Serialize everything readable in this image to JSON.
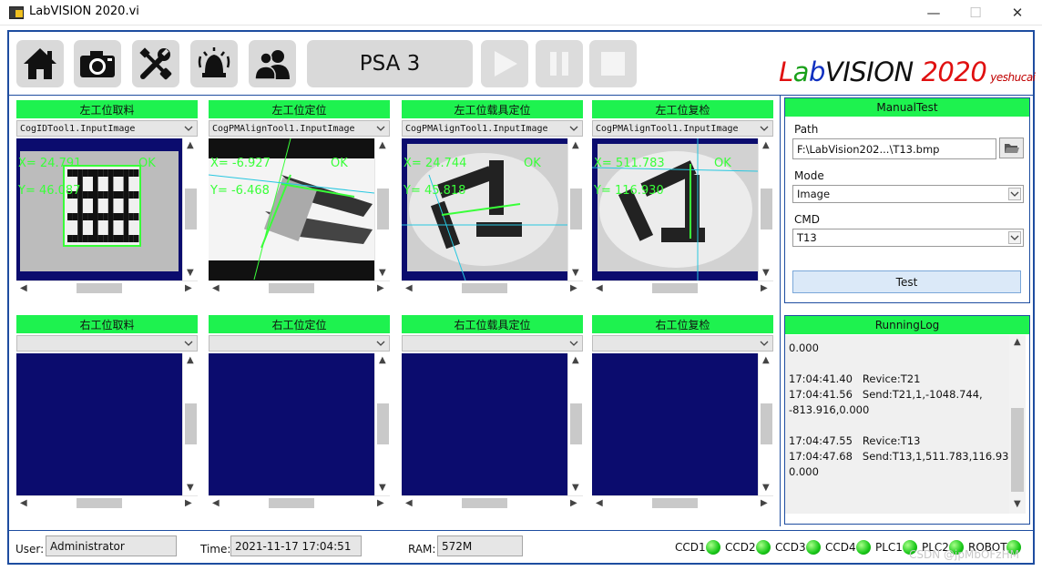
{
  "window": {
    "title": "LabVISION 2020.vi",
    "minimize_glyph": "—",
    "maximize_glyph": "☐",
    "close_glyph": "✕"
  },
  "toolbar": {
    "buttons": [
      {
        "icon": "home-icon"
      },
      {
        "icon": "camera-icon"
      },
      {
        "icon": "tools-icon"
      },
      {
        "icon": "alarm-icon"
      },
      {
        "icon": "users-icon"
      }
    ],
    "recipe_label": "PSA 3",
    "run_icon": "play-icon",
    "pause_icon": "pause-icon",
    "stop_icon": "stop-icon"
  },
  "logo": {
    "l": "L",
    "a": "a",
    "b": "b",
    "vision": "VISION",
    "year": "2020",
    "author": "yeshucai"
  },
  "cameras_top": [
    {
      "title": "左工位取料",
      "tool": "CogIDTool1.InputImage",
      "ok": "OK",
      "x": "X= 24.791",
      "y": "Y= 46.087"
    },
    {
      "title": "左工位定位",
      "tool": "CogPMAlignTool1.InputImage",
      "ok": "OK",
      "x": "X= -6.927",
      "y": "Y= -6.468"
    },
    {
      "title": "左工位载具定位",
      "tool": "CogPMAlignTool1.InputImage",
      "ok": "OK",
      "x": "X= 24.744",
      "y": "Y= 45.818"
    },
    {
      "title": "左工位复检",
      "tool": "CogPMAlignTool1.InputImage",
      "ok": "OK",
      "x": "X= 511.783",
      "y": "Y= 116.930"
    }
  ],
  "cameras_bottom": [
    {
      "title": "右工位取料",
      "tool": ""
    },
    {
      "title": "右工位定位",
      "tool": ""
    },
    {
      "title": "右工位载具定位",
      "tool": ""
    },
    {
      "title": "右工位复检",
      "tool": ""
    }
  ],
  "manual_test": {
    "title": "ManualTest",
    "path_label": "Path",
    "path_value": "F:\\LabVision202...\\T13.bmp",
    "folder_icon": "folder-icon",
    "mode_label": "Mode",
    "mode_value": "Image",
    "cmd_label": "CMD",
    "cmd_value": "T13",
    "test_label": "Test"
  },
  "running_log": {
    "title": "RunningLog",
    "lines": [
      "0.000",
      "",
      "17:04:41.40   Revice:T21",
      "17:04:41.56   Send:T21,1,-1048.744,",
      "-813.916,0.000",
      "",
      "17:04:47.55   Revice:T13",
      "17:04:47.68   Send:T13,1,511.783,116.930,",
      "0.000"
    ]
  },
  "status": {
    "user_label": "User:",
    "user_value": "Administrator",
    "time_label": "Time:",
    "time_value": "2021-11-17 17:04:51",
    "ram_label": "RAM:",
    "ram_value": "572M",
    "indicators": [
      "CCD1",
      "CCD2",
      "CCD3",
      "CCD4",
      "PLC1",
      "PLC2",
      "ROBOT"
    ],
    "indicator_color": "#19c819"
  },
  "watermark": "CSDN @jpMbOFzHM",
  "colors": {
    "accent": "#1e4da0",
    "header_green": "#1ef24f",
    "view_bg": "#0b0c6e",
    "overlay": "#39ff39"
  }
}
